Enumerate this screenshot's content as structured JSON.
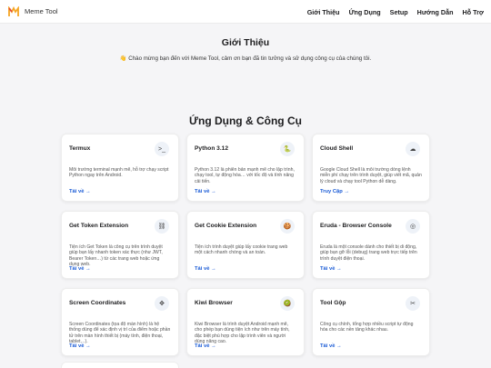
{
  "header": {
    "brand": "Meme Tool",
    "nav": [
      "Giới Thiệu",
      "Ứng Dụng",
      "Setup",
      "Hướng Dẫn",
      "Hỗ Trợ"
    ]
  },
  "intro": {
    "title": "Giới Thiệu",
    "text": "👋 Chào mừng bạn đến với Meme Tool, cảm ơn bạn đã tin tưởng và sử dụng công cụ của chúng tôi."
  },
  "apps": {
    "title": "Ứng Dụng & Công Cụ",
    "cards": [
      {
        "title": "Termux",
        "icon": "terminal-icon",
        "glyph": ">_",
        "desc": "Môi trường terminal mạnh mẽ, hỗ trợ chạy script Python ngay trên Android.",
        "link": "Tải về →"
      },
      {
        "title": "Python 3.12",
        "icon": "python-icon",
        "glyph": "🐍",
        "desc": "Python 3.12 là phiên bản mạnh mẽ cho lập trình, chạy tool, tự động hóa… với tốc độ và tính năng cải tiến.",
        "link": "Tải về →"
      },
      {
        "title": "Cloud Shell",
        "icon": "cloud-shell-icon",
        "glyph": "☁",
        "desc": "Google Cloud Shell là môi trường dòng lệnh miễn phí chạy trên trình duyệt, giúp viết mã, quản lý cloud và chạy tool Python dễ dàng.",
        "link": "Truy Cập →"
      },
      {
        "title": "Get Token Extension",
        "icon": "token-icon",
        "glyph": "⛓",
        "desc": "Tiện ích Get Token là công cụ trên trình duyệt giúp bạn lấy nhanh token xác thực (như JWT, Bearer Token…) từ các trang web hoặc ứng dụng web.",
        "link": "Tải về →"
      },
      {
        "title": "Get Cookie Extension",
        "icon": "cookie-icon",
        "glyph": "🍪",
        "desc": "Tiện ích trình duyệt giúp lấy cookie trang web một cách nhanh chóng và an toàn.",
        "link": "Tải về →"
      },
      {
        "title": "Eruda - Browser Console",
        "icon": "console-icon",
        "glyph": "◎",
        "desc": "Eruda là một console dành cho thiết bị di động, giúp bạn gỡ lỗi (debug) trang web trực tiếp trên trình duyệt điện thoại.",
        "link": "Tải về →"
      },
      {
        "title": "Screen Coordinates",
        "icon": "cursor-icon",
        "glyph": "✥",
        "desc": "Screen Coordinates (tọa độ màn hình) là hệ thống dùng để xác định vị trí của điểm hoặc phần tử trên màn hình thiết bị (máy tính, điện thoại, tablet…).",
        "link": "Tải về →"
      },
      {
        "title": "Kiwi Browser",
        "icon": "kiwi-icon",
        "glyph": "🥝",
        "desc": "Kiwi Browser là trình duyệt Android mạnh mẽ, cho phép bạn dùng tiện ích như trên máy tính, đặc biệt phù hợp cho lập trình viên và người dùng nâng cao.",
        "link": "Tải về →"
      },
      {
        "title": "Tool Gộp",
        "icon": "tools-icon",
        "glyph": "✂",
        "desc": "Công cụ chính, tổng hợp nhiều script tự động hóa cho các nền tảng khác nhau.",
        "link": "Tải về →"
      }
    ]
  }
}
